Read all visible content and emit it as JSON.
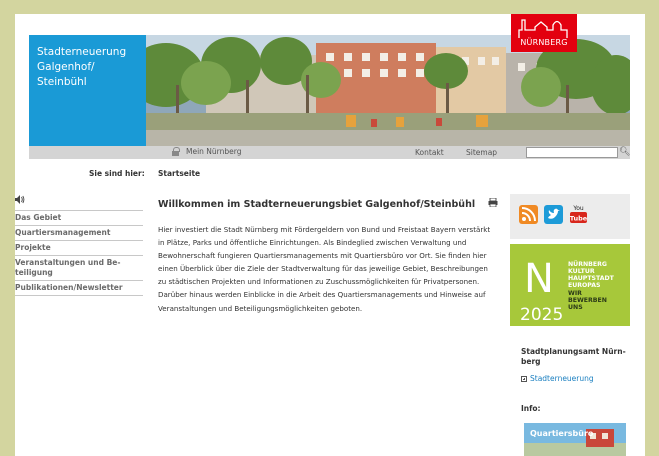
{
  "header": {
    "site_title": "Stadterneuerung Galgenhof/ Steinbühl",
    "logo_text": "NÜRNBERG"
  },
  "utilbar": {
    "mein_nuernberg": "Mein Nürnberg",
    "kontakt": "Kontakt",
    "sitemap": "Sitemap",
    "search_value": ""
  },
  "breadcrumb": {
    "label": "Sie sind hier:",
    "current": "Startseite"
  },
  "nav": {
    "items": [
      {
        "label": "Das Gebiet"
      },
      {
        "label": "Quartiersmanagement"
      },
      {
        "label": "Projekte"
      },
      {
        "label": "Veranstaltungen und Be-teiligung"
      },
      {
        "label": "Publikationen/Newsletter"
      }
    ]
  },
  "main": {
    "heading": "Willkommen im Stadterneuerungsbiet Galgenhof/Steinbühl",
    "text": "Hier investiert die Stadt Nürnberg mit Fördergeldern von Bund und Freistaat Bayern verstärkt in Plätze, Parks und öffentliche Einrichtungen. Als Bindeglied zwischen Verwaltung und Bewohnerschaft fungieren Quartiersmanagements mit Quartiersbüro vor Ort. Sie finden hier einen Überblick über die Ziele der Stadtverwaltung für das jeweilige Gebiet, Beschreibungen zu städtischen Projekten und Informationen zu Zuschussmöglichkeiten für Privatpersonen. Darüber hinaus werden Einblicke in die Arbeit des Quartiersmanagements und Hinweise auf Veranstaltungen und Beteiligungsmöglichkeiten geboten."
  },
  "sidebar": {
    "social": {
      "youtube_label": "You Tube"
    },
    "kulturhauptstadt": {
      "big_n": "N",
      "year": "2025",
      "lines": [
        "NÜRNBERG",
        "KULTUR",
        "HAUPTSTADT",
        "EUROPAS"
      ],
      "cta_lines": [
        "WIR",
        "BEWERBEN",
        "UNS"
      ]
    },
    "office_heading": "Stadtplanungsamt Nürn-berg",
    "office_link": "Stadterneuerung",
    "info_heading": "Info:",
    "info_image_text": "Quartiersbüro"
  },
  "colors": {
    "background": "#d3d59f",
    "title_box": "#1a9ad6",
    "logo_red": "#e3000f",
    "n2025_green": "#a7c83a",
    "link_blue": "#1a7fc0"
  }
}
